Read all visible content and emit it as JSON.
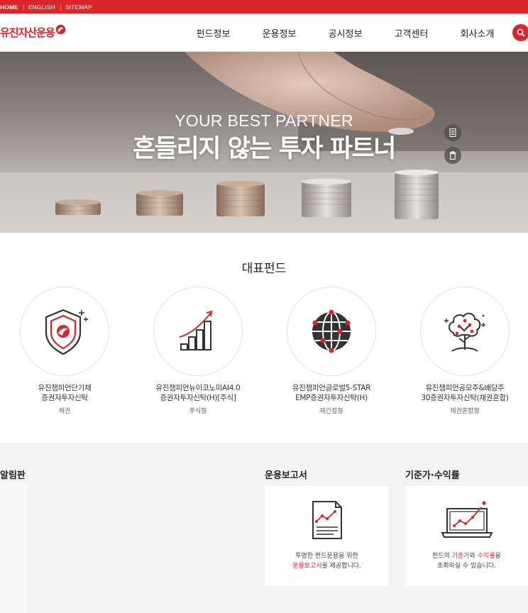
{
  "top_links": [
    "HOME",
    "ENGLISH",
    "SITEMAP"
  ],
  "logo": {
    "text": "유진자산운용"
  },
  "nav": [
    "펀드정보",
    "운용정보",
    "공시정보",
    "고객센터",
    "회사소개"
  ],
  "icons": {
    "search": "search-icon",
    "hero_doc": "document-icon",
    "hero_trash": "trash-icon"
  },
  "colors": {
    "brand_red": "#d9262a",
    "bottom_bg": "#f3f3f3"
  },
  "hero": {
    "subtitle": "YOUR BEST PARTNER",
    "title": "흔들리지 않는 투자 파트너"
  },
  "featured": {
    "title": "대표펀드",
    "funds": [
      {
        "name": "유진챔피언단기채\n증권자투자신탁",
        "type": "채권",
        "icon": "shield-icon"
      },
      {
        "name": "유진챔피언뉴이코노미AI4.0\n증권자투자신탁(H)[주식]",
        "type": "주식형",
        "icon": "growth-chart-icon"
      },
      {
        "name": "유진챔피언글로벌5-STAR\nEMP증권자투자신탁(H)",
        "type": "재간접형",
        "icon": "globe-icon"
      },
      {
        "name": "유진챔피언공모주&배당주\n30증권자투자신탁(채권혼합)",
        "type": "채권혼합형",
        "icon": "tree-icon"
      }
    ]
  },
  "board": {
    "title": "알림판"
  },
  "reports": {
    "title": "운용보고서",
    "desc_line1": "투명한 펀드운용을 위한",
    "desc_highlight": "운용보고서",
    "desc_rest": "를 제공합니다."
  },
  "nav_returns": {
    "title": "기준가·수익률",
    "desc_prefix": "펀드의 ",
    "desc_hl1": "기준가",
    "desc_mid": "와 ",
    "desc_hl2": "수익률",
    "desc_suffix": "을",
    "desc_line2": "조회하실 수 있습니다."
  }
}
